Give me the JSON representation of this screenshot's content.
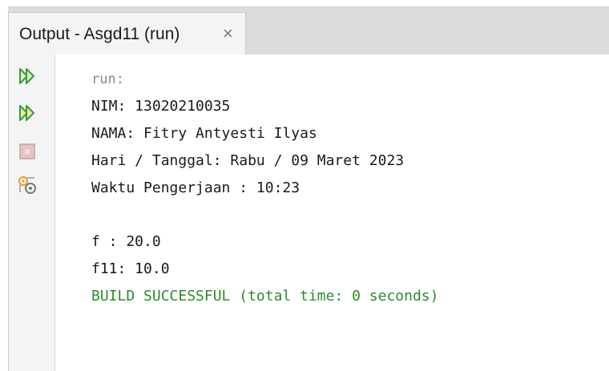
{
  "tab": {
    "title": "Output - Asgd11 (run)",
    "close_glyph": "×"
  },
  "toolbar": {
    "buttons": [
      {
        "icon": "rerun-icon",
        "color": "#3a9a3a"
      },
      {
        "icon": "rerun-with-options-icon",
        "color": "#3a9a3a"
      },
      {
        "icon": "stop-icon",
        "color": "#c88a8a"
      },
      {
        "icon": "settings-icon",
        "color": "#8a8a8a"
      }
    ]
  },
  "console": {
    "lines": [
      "run:",
      "NIM: 13020210035",
      "NAMA: Fitry Antyesti Ilyas",
      "Hari / Tanggal: Rabu / 09 Maret 2023",
      "Waktu Pengerjaan : 10:23",
      "",
      "f : 20.0",
      "f11: 10.0",
      "BUILD SUCCESSFUL (total time: 0 seconds)"
    ]
  },
  "colors": {
    "success": "#2e8a2e",
    "muted": "#8a8a8a",
    "tab_bar": "#dcdcdc"
  }
}
